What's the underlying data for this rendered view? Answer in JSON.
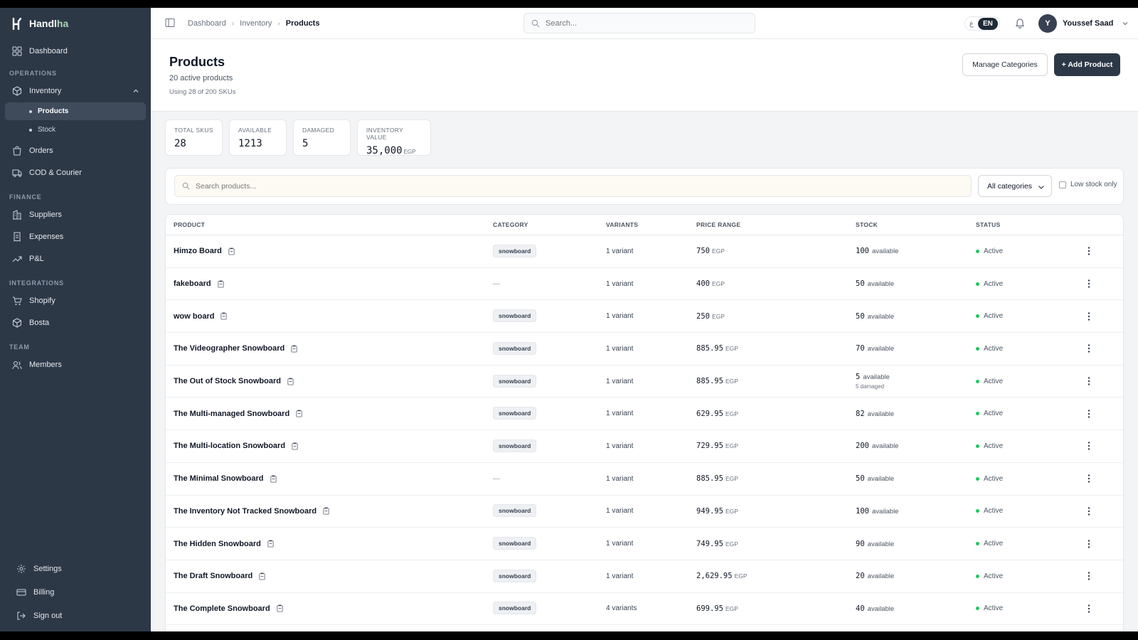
{
  "brand": {
    "name_main": "Handl",
    "name_accent": "ha"
  },
  "sidebar": {
    "dashboard": "Dashboard",
    "sections": {
      "operations": "OPERATIONS",
      "finance": "FINANCE",
      "integrations": "INTEGRATIONS",
      "team": "TEAM"
    },
    "inventory": "Inventory",
    "inventory_sub": [
      {
        "label": "Products"
      },
      {
        "label": "Stock"
      }
    ],
    "orders": "Orders",
    "cod": "COD & Courier",
    "suppliers": "Suppliers",
    "expenses": "Expenses",
    "pnl": "P&L",
    "shopify": "Shopify",
    "bosta": "Bosta",
    "members": "Members",
    "settings": "Settings",
    "billing": "Billing",
    "signout": "Sign out"
  },
  "topbar": {
    "breadcrumb": [
      "Dashboard",
      "Inventory",
      "Products"
    ],
    "search_placeholder": "Search...",
    "lang_ar": "ع",
    "lang_en": "EN",
    "user_initial": "Y",
    "user_name": "Youssef Saad"
  },
  "header": {
    "title": "Products",
    "subtitle": "20 active products",
    "usage": "Using 28 of 200 SKUs",
    "manage_categories": "Manage Categories",
    "add_product": "+ Add Product"
  },
  "stats": [
    {
      "label": "TOTAL SKUS",
      "value": "28",
      "unit": ""
    },
    {
      "label": "AVAILABLE",
      "value": "1213",
      "unit": ""
    },
    {
      "label": "DAMAGED",
      "value": "5",
      "unit": ""
    },
    {
      "label": "INVENTORY VALUE",
      "value": "35,000",
      "unit": "EGP"
    }
  ],
  "filters": {
    "search_placeholder": "Search products...",
    "category": "All categories",
    "low_stock": "Low stock only"
  },
  "table": {
    "headers": {
      "product": "PRODUCT",
      "category": "CATEGORY",
      "variants": "VARIANTS",
      "price": "PRICE RANGE",
      "stock": "STOCK",
      "status": "STATUS"
    },
    "rows": [
      {
        "name": "Himzo Board",
        "category": "snowboard",
        "variants": "1 variant",
        "price": "750",
        "currency": "EGP",
        "stock": "100",
        "stock_label": "available",
        "damaged": "",
        "status": "Active"
      },
      {
        "name": "fakeboard",
        "category": "",
        "variants": "1 variant",
        "price": "400",
        "currency": "EGP",
        "stock": "50",
        "stock_label": "available",
        "damaged": "",
        "status": "Active"
      },
      {
        "name": "wow board",
        "category": "snowboard",
        "variants": "1 variant",
        "price": "250",
        "currency": "EGP",
        "stock": "50",
        "stock_label": "available",
        "damaged": "",
        "status": "Active"
      },
      {
        "name": "The Videographer Snowboard",
        "category": "snowboard",
        "variants": "1 variant",
        "price": "885.95",
        "currency": "EGP",
        "stock": "70",
        "stock_label": "available",
        "damaged": "",
        "status": "Active"
      },
      {
        "name": "The Out of Stock Snowboard",
        "category": "snowboard",
        "variants": "1 variant",
        "price": "885.95",
        "currency": "EGP",
        "stock": "5",
        "stock_label": "available",
        "damaged": "5 damaged",
        "status": "Active"
      },
      {
        "name": "The Multi-managed Snowboard",
        "category": "snowboard",
        "variants": "1 variant",
        "price": "629.95",
        "currency": "EGP",
        "stock": "82",
        "stock_label": "available",
        "damaged": "",
        "status": "Active"
      },
      {
        "name": "The Multi-location Snowboard",
        "category": "snowboard",
        "variants": "1 variant",
        "price": "729.95",
        "currency": "EGP",
        "stock": "200",
        "stock_label": "available",
        "damaged": "",
        "status": "Active"
      },
      {
        "name": "The Minimal Snowboard",
        "category": "",
        "variants": "1 variant",
        "price": "885.95",
        "currency": "EGP",
        "stock": "50",
        "stock_label": "available",
        "damaged": "",
        "status": "Active"
      },
      {
        "name": "The Inventory Not Tracked Snowboard",
        "category": "snowboard",
        "variants": "1 variant",
        "price": "949.95",
        "currency": "EGP",
        "stock": "100",
        "stock_label": "available",
        "damaged": "",
        "status": "Active"
      },
      {
        "name": "The Hidden Snowboard",
        "category": "snowboard",
        "variants": "1 variant",
        "price": "749.95",
        "currency": "EGP",
        "stock": "90",
        "stock_label": "available",
        "damaged": "",
        "status": "Active"
      },
      {
        "name": "The Draft Snowboard",
        "category": "snowboard",
        "variants": "1 variant",
        "price": "2,629.95",
        "currency": "EGP",
        "stock": "20",
        "stock_label": "available",
        "damaged": "",
        "status": "Active"
      },
      {
        "name": "The Complete Snowboard",
        "category": "snowboard",
        "variants": "4 variants",
        "price": "699.95",
        "currency": "EGP",
        "stock": "40",
        "stock_label": "available",
        "damaged": "",
        "status": "Active"
      }
    ],
    "empty_category": "—"
  },
  "colors": {
    "sidebar_bg": "#2d3847",
    "primary_button": "#2d3847",
    "status_active": "#22c55e",
    "brand_accent": "#a7d6b8"
  }
}
